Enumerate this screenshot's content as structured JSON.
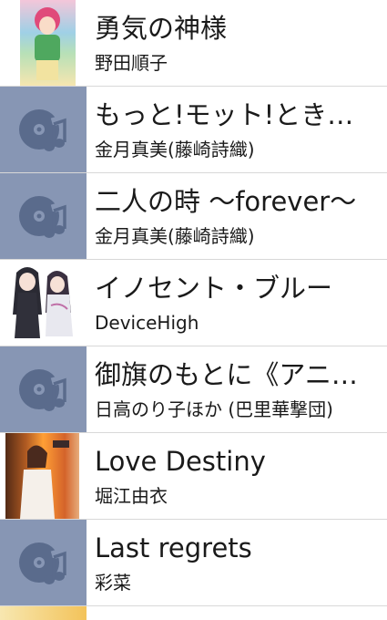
{
  "songs": [
    {
      "title": "勇気の神様",
      "artist": "野田順子",
      "art": "album-art"
    },
    {
      "title": "もっと!モット!ときめ…",
      "artist": "金月真美(藤崎詩織)",
      "art": "music-note-placeholder"
    },
    {
      "title": "二人の時 〜forever〜",
      "artist": "金月真美(藤崎詩織)",
      "art": "music-note-placeholder"
    },
    {
      "title": "イノセント・ブルー",
      "artist": "DeviceHigh",
      "art": "album-art"
    },
    {
      "title": "御旗のもとに《アニ…",
      "artist": "日高のり子ほか (巴里華撃団)",
      "art": "music-note-placeholder"
    },
    {
      "title": "Love Destiny",
      "artist": "堀江由衣",
      "art": "album-art"
    },
    {
      "title": "Last regrets",
      "artist": "彩菜",
      "art": "music-note-placeholder"
    }
  ],
  "colors": {
    "placeholder_bg": "#8796b4",
    "placeholder_icon": "#5a6b8c",
    "divider": "#d8d8d8"
  }
}
